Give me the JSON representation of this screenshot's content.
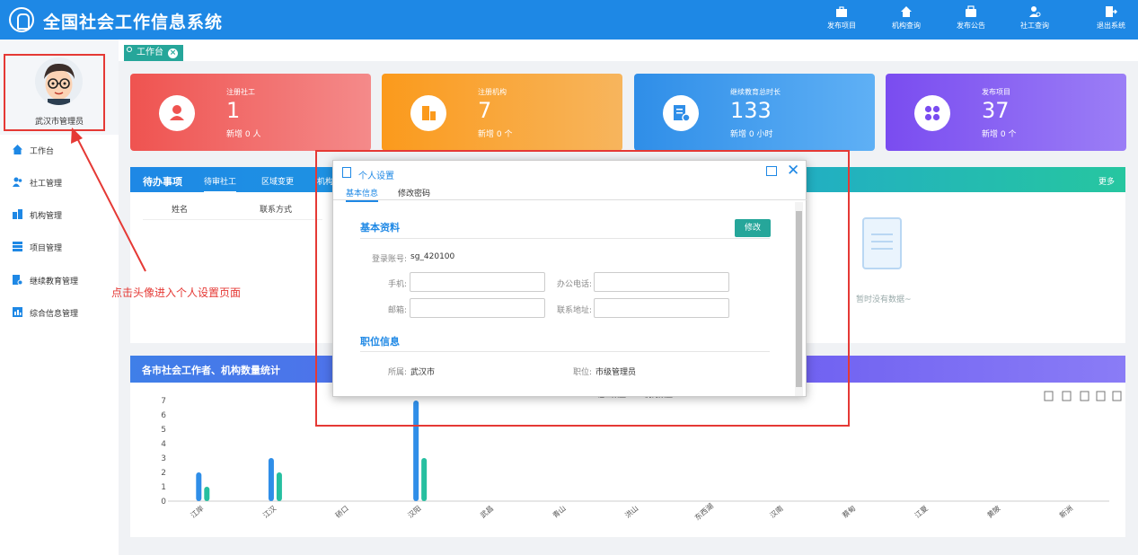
{
  "app": {
    "title": "全国社会工作信息系统"
  },
  "nav": [
    {
      "label": "发布项目",
      "icon": "briefcase-icon"
    },
    {
      "label": "机构查询",
      "icon": "home-icon"
    },
    {
      "label": "发布公告",
      "icon": "notice-icon"
    },
    {
      "label": "社工查询",
      "icon": "user-search-icon"
    },
    {
      "label": "退出系统",
      "icon": "logout-icon"
    }
  ],
  "profile": {
    "name": "武汉市管理员"
  },
  "sidebar": {
    "items": [
      {
        "label": "工作台",
        "icon": "home-icon"
      },
      {
        "label": "社工管理",
        "icon": "users-icon"
      },
      {
        "label": "机构管理",
        "icon": "building-icon"
      },
      {
        "label": "项目管理",
        "icon": "list-icon"
      },
      {
        "label": "继续教育管理",
        "icon": "education-icon"
      },
      {
        "label": "综合信息管理",
        "icon": "chart-icon"
      }
    ]
  },
  "tab": {
    "label": "工作台"
  },
  "cards": [
    {
      "label": "注册社工",
      "value": "1",
      "sub": "新增 0 人",
      "color_start": "#ef5350",
      "color_end": "#f48a8a"
    },
    {
      "label": "注册机构",
      "value": "7",
      "sub": "新增 0 个",
      "color_start": "#fb9a1c",
      "color_end": "#f7b55d"
    },
    {
      "label": "继续教育总时长",
      "value": "133",
      "sub": "新增 0 小时",
      "color_start": "#2f8ee8",
      "color_end": "#5fb0f5"
    },
    {
      "label": "发布项目",
      "value": "37",
      "sub": "新增 0 个",
      "color_start": "#7a4cf0",
      "color_end": "#9b7ef6"
    }
  ],
  "todo": {
    "title": "待办事项",
    "tabs": [
      "待审社工",
      "区域变更",
      "机构"
    ],
    "more": "更多",
    "columns": [
      "姓名",
      "联系方式"
    ],
    "empty": "暂时没有数据~"
  },
  "stats": {
    "title": "各市社会工作者、机构数量统计"
  },
  "chart_data": {
    "type": "bar",
    "title": "各市社会工作者、机构数量统计",
    "categories": [
      "江岸",
      "江汉",
      "硚口",
      "汉阳",
      "武昌",
      "青山",
      "洪山",
      "东西湖",
      "汉南",
      "蔡甸",
      "江夏",
      "黄陂",
      "新洲"
    ],
    "series": [
      {
        "name": "社工数量",
        "values": [
          2,
          3,
          0,
          7,
          0,
          0,
          0,
          0,
          0,
          0,
          0,
          0,
          0
        ],
        "color": "#2f8ee8"
      },
      {
        "name": "机构数量",
        "values": [
          1,
          2,
          0,
          3,
          0,
          0,
          0,
          0,
          0,
          0,
          0,
          0,
          0
        ],
        "color": "#26bfa0"
      }
    ],
    "yticks": [
      "0",
      "1",
      "2",
      "3",
      "4",
      "5",
      "6",
      "7"
    ],
    "ylim": [
      0,
      7
    ],
    "grid": false,
    "legend": "top-center",
    "toolbox": [
      "data-view-icon",
      "line-icon",
      "bar-icon",
      "refresh-icon",
      "download-icon"
    ]
  },
  "dialog": {
    "title": "个人设置",
    "tabs": [
      "基本信息",
      "修改密码"
    ],
    "basic_title": "基本资料",
    "edit_button": "修改",
    "account_label": "登录账号:",
    "account_value": "sg_420100",
    "phone_label": "手机:",
    "office_phone_label": "办公电话:",
    "email_label": "邮箱:",
    "address_label": "联系地址:",
    "position_title": "职位信息",
    "belong_label": "所属:",
    "belong_value": "武汉市",
    "job_label": "职位:",
    "job_value": "市级管理员"
  },
  "annotation": {
    "text": "点击头像进入个人设置页面",
    "color": "#e53935"
  }
}
